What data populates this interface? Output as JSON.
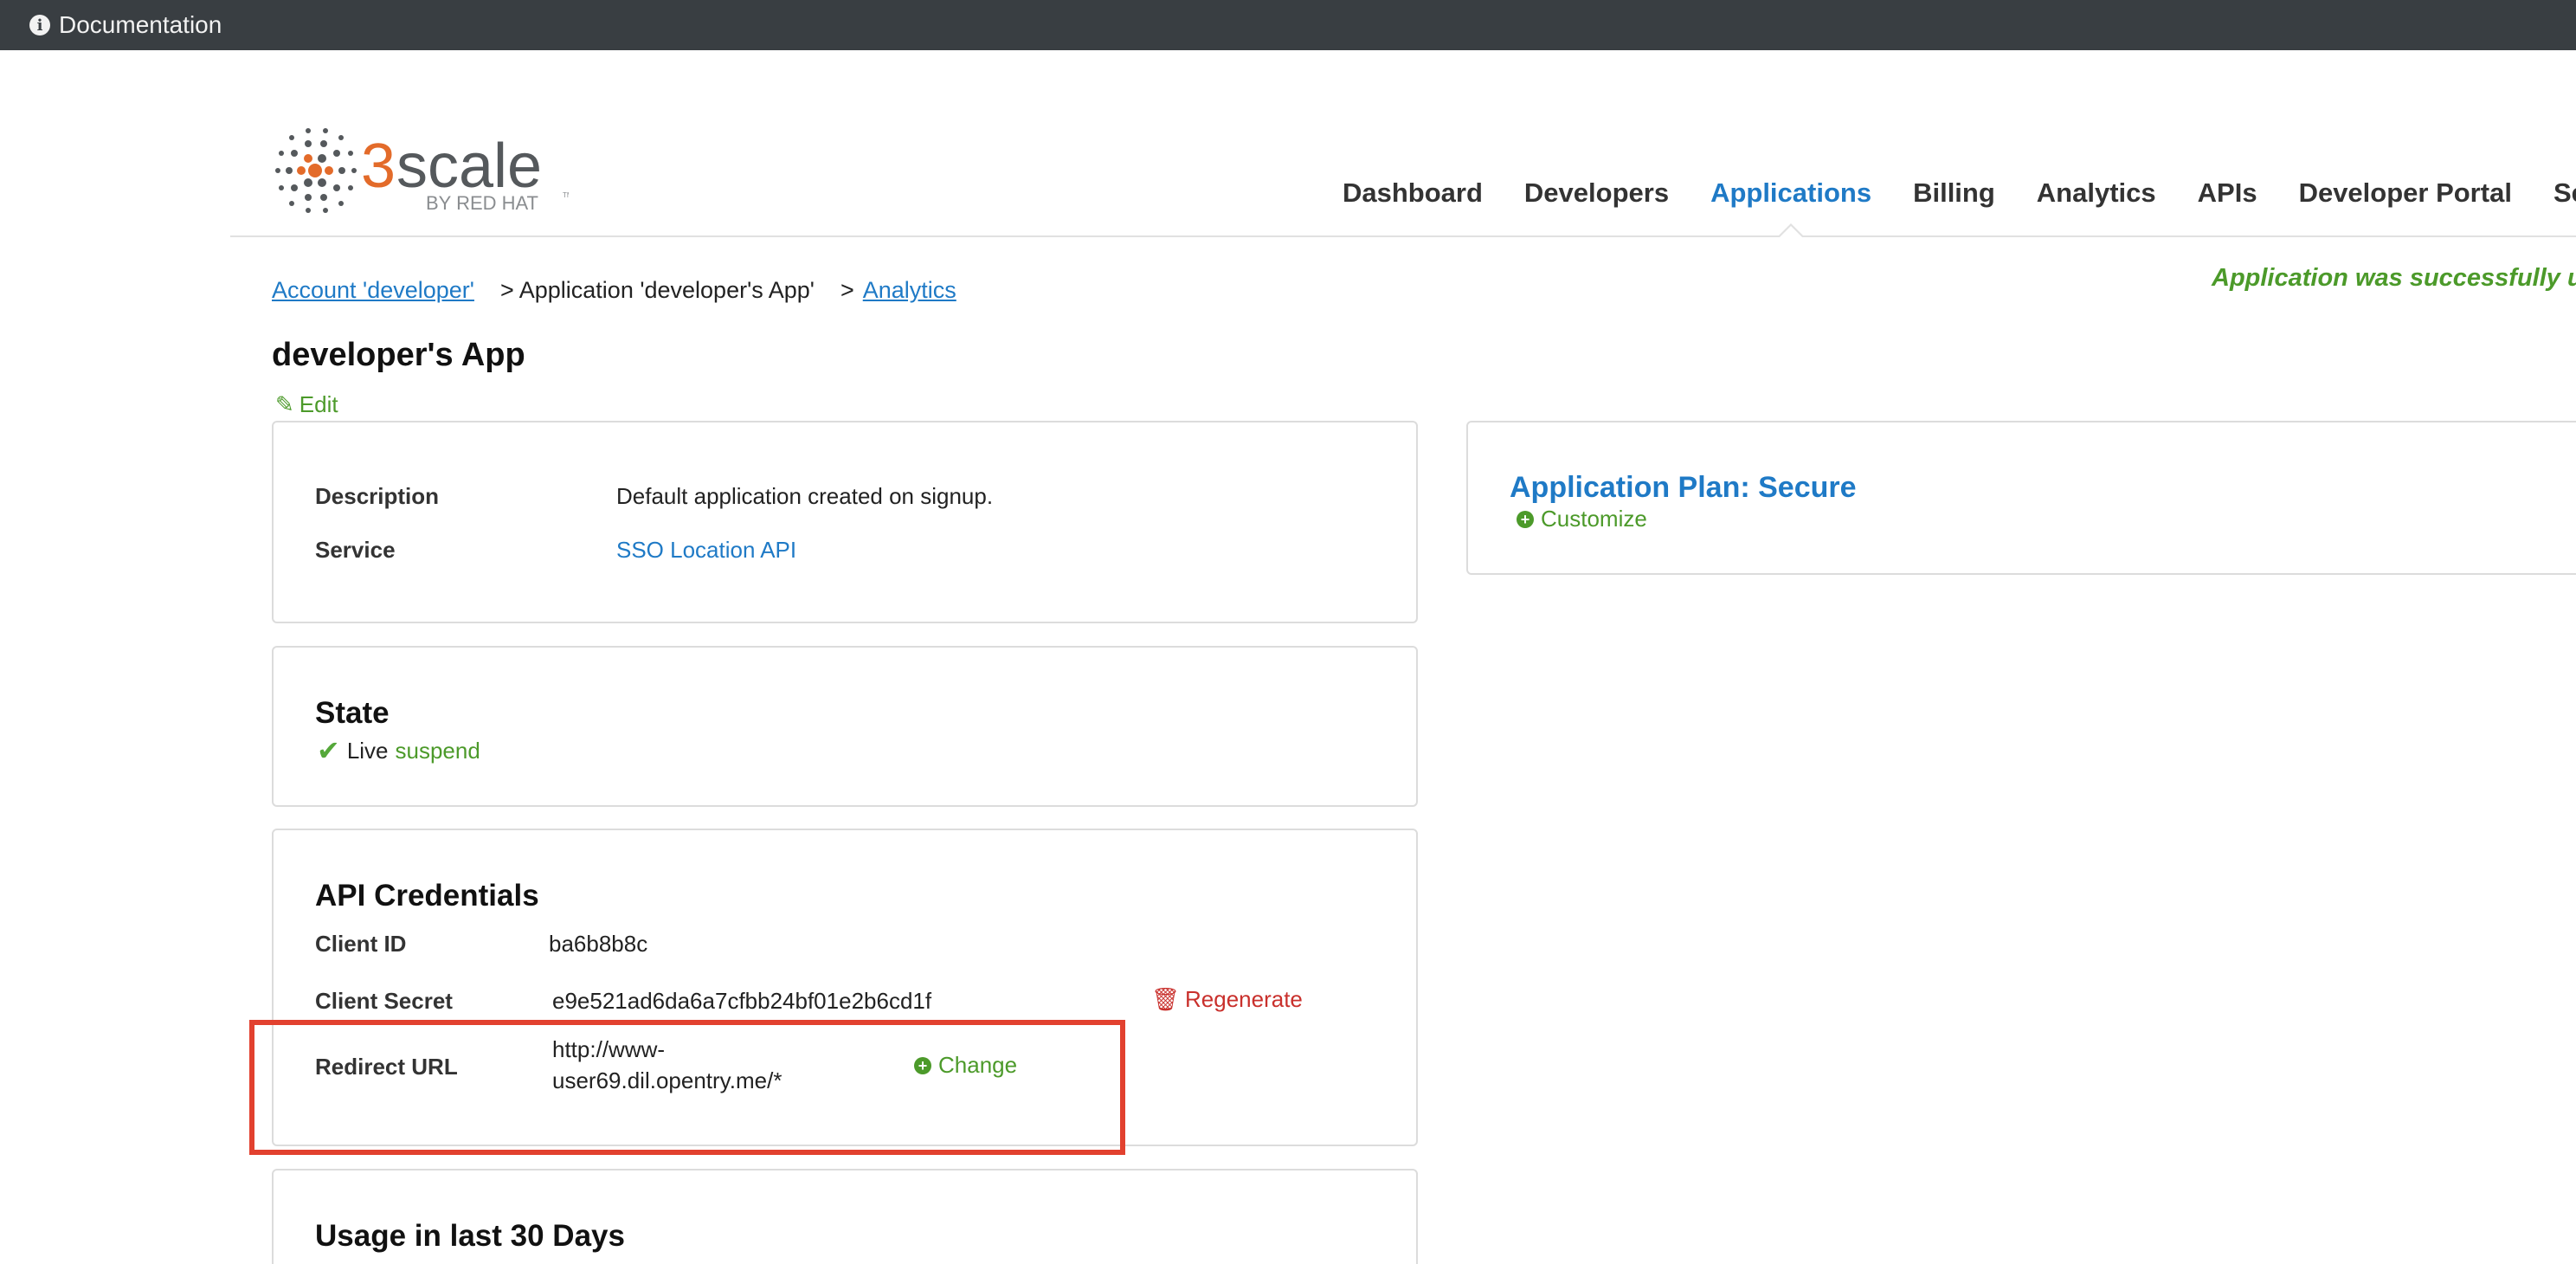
{
  "topbar": {
    "documentation_label": "Documentation",
    "info_icon": "info-icon"
  },
  "logo": {
    "main": "3scale",
    "sub": "BY RED HAT",
    "mark": "TM"
  },
  "nav": {
    "items": [
      {
        "label": "Dashboard"
      },
      {
        "label": "Developers"
      },
      {
        "label": "Applications",
        "active": true
      },
      {
        "label": "Billing"
      },
      {
        "label": "Analytics"
      },
      {
        "label": "APIs"
      },
      {
        "label": "Developer Portal"
      },
      {
        "label": "Setti"
      }
    ]
  },
  "breadcrumb": {
    "account": "Account 'developer'",
    "application": "> Application 'developer's App'",
    "analytics_sep": ">",
    "analytics": "Analytics"
  },
  "flash": {
    "message": "Application was successfully up"
  },
  "page": {
    "title": "developer's App",
    "edit_label": "Edit"
  },
  "details": {
    "description_label": "Description",
    "description_value": "Default application created on signup.",
    "service_label": "Service",
    "service_value": "SSO Location API"
  },
  "state": {
    "title": "State",
    "status": "Live",
    "action": "suspend"
  },
  "credentials": {
    "title": "API Credentials",
    "client_id_label": "Client ID",
    "client_id_value": "ba6b8b8c",
    "client_secret_label": "Client Secret",
    "client_secret_value": "e9e521ad6da6a7cfbb24bf01e2b6cd1f",
    "regenerate_label": "Regenerate",
    "redirect_label": "Redirect URL",
    "redirect_value_line1": "http://www-",
    "redirect_value_line2": "user69.dil.opentry.me/*",
    "change_label": "Change"
  },
  "usage": {
    "title": "Usage in last 30 Days"
  },
  "plan": {
    "title": "Application Plan: Secure",
    "customize_label": "Customize"
  },
  "colors": {
    "accent_blue": "#1f7ac6",
    "success_green": "#4c9a2a",
    "danger_red": "#c9302c",
    "highlight_red": "#e2412f",
    "topbar": "#393e42",
    "logo_orange": "#e36b2a"
  }
}
